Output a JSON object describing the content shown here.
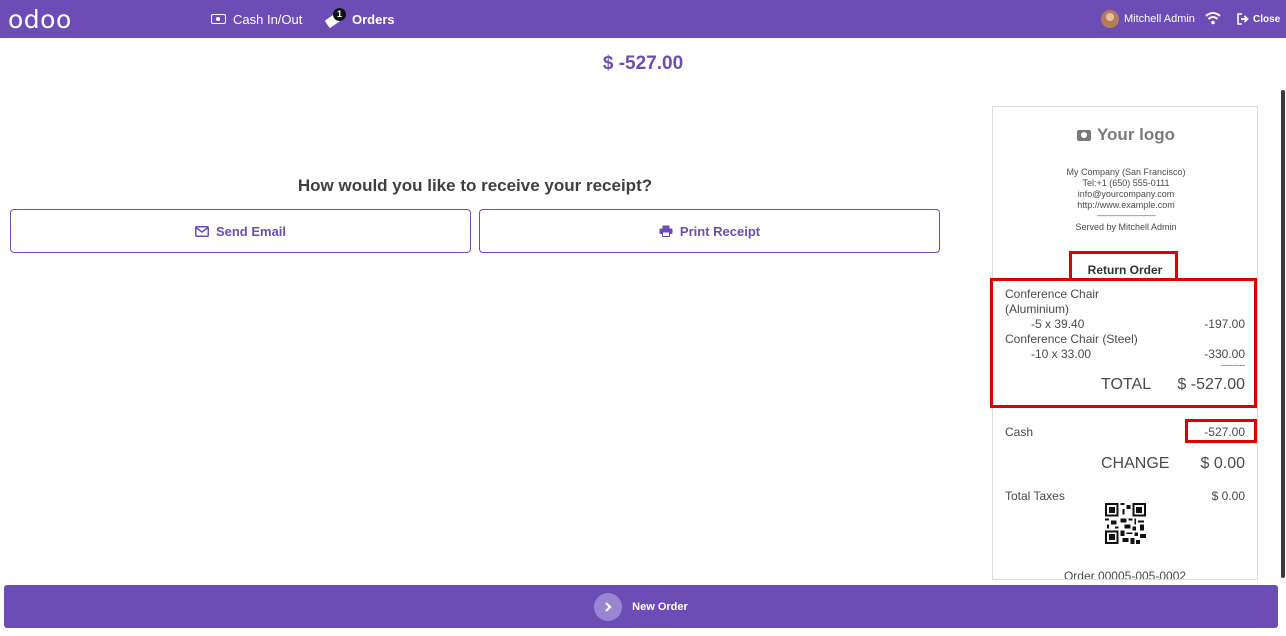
{
  "topbar": {
    "logo": "odoo",
    "cash_label": "Cash In/Out",
    "orders_label": "Orders",
    "orders_badge": "1",
    "user_name": "Mitchell Admin",
    "close_label": "Close",
    "bg_color": "#6b4db5"
  },
  "main": {
    "amount": "$ -527.00",
    "question": "How would you like to receive your receipt?",
    "email_button": "Send Email",
    "print_button": "Print Receipt"
  },
  "receipt": {
    "logo_text": "Your logo",
    "company_lines": [
      "My Company (San Francisco)",
      "Tel:+1 (650) 555-0111",
      "info@yourcompany.com",
      "http://www.example.com",
      "--------------------------------",
      "Served by Mitchell Admin"
    ],
    "title": "Return Order",
    "lines": [
      {
        "product_l1": "Conference Chair",
        "product_l2": "(Aluminium)",
        "qty": "-5 x 39.40",
        "amount": "-197.00"
      },
      {
        "product_l1": "Conference Chair (Steel)",
        "qty": "-10 x 33.00",
        "amount": "-330.00"
      }
    ],
    "separator": "--------",
    "total_label": "TOTAL",
    "total_value": "$ -527.00",
    "payment_label": "Cash",
    "payment_value": "-527.00",
    "change_label": "CHANGE",
    "change_value": "$ 0.00",
    "taxes_label": "Total Taxes",
    "taxes_value": "$ 0.00",
    "order_ref": "Order 00005-005-0002"
  },
  "bottombar": {
    "new_order_label": "New Order"
  },
  "highlight_color": "#e00000"
}
